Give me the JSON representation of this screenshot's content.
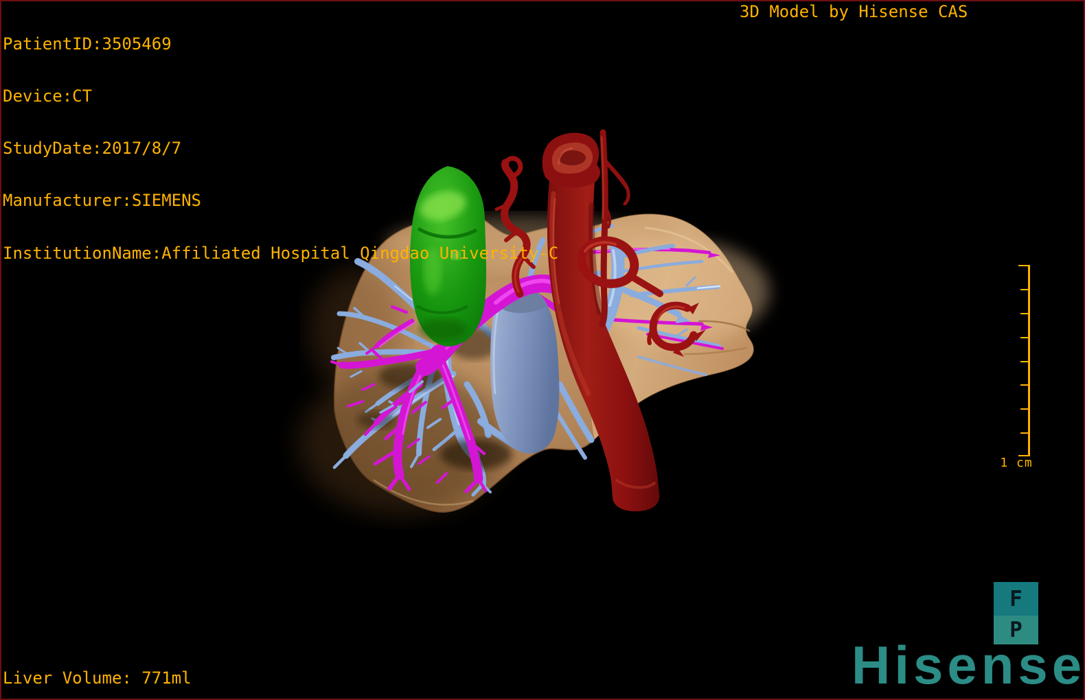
{
  "overlay": {
    "top_left_lines": [
      "PatientID:3505469",
      "Device:CT",
      "StudyDate:2017/8/7",
      "Manufacturer:SIEMENS",
      "InstitutionName:Affiliated Hospital Qingdao University-C"
    ],
    "top_right": "3D Model by Hisense CAS",
    "bottom_left": "Liver Volume: 771ml"
  },
  "scale_bar": {
    "label": "1 cm",
    "segments": 8
  },
  "orientation_marker": {
    "top_label": "F",
    "bottom_label": "P"
  },
  "branding": {
    "logo_text": "Hisense"
  },
  "model": {
    "structures": [
      {
        "name": "liver",
        "color": "#BE8F5E"
      },
      {
        "name": "gallbladder",
        "color": "#1FA115"
      },
      {
        "name": "artery-aorta",
        "color": "#971111"
      },
      {
        "name": "portal-vein",
        "color": "#D415D4"
      },
      {
        "name": "hepatic-veins",
        "color": "#8AACDE"
      },
      {
        "name": "inferior-vena-cava",
        "color": "#7C91BB"
      }
    ]
  },
  "colors": {
    "overlay_text": "#FFB300",
    "background": "#000000",
    "frame_border": "#6E0F12",
    "logo_teal": "#2C8C86",
    "marker_top": "#15797E",
    "marker_bottom": "#2E8B82"
  }
}
